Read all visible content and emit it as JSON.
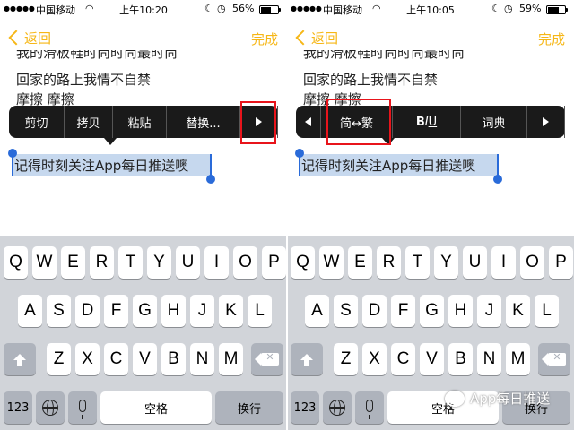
{
  "left": {
    "status": {
      "carrier": "中国移动",
      "time": "上午10:20",
      "battery": "56%",
      "battery_level": 0.56
    },
    "nav": {
      "back_label": "返回",
      "done_label": "完成"
    },
    "note": {
      "partial_line": "我的滑板鞋时尚时尚最时尚",
      "line2": "回家的路上我情不自禁",
      "line3": "摩擦 摩擦",
      "selected": "记得时刻关注App每日推送噢"
    },
    "menu": {
      "cut": "剪切",
      "copy": "拷贝",
      "paste": "粘贴",
      "replace": "替换..."
    }
  },
  "right": {
    "status": {
      "carrier": "中国移动",
      "time": "上午10:05",
      "battery": "59%",
      "battery_level": 0.59
    },
    "nav": {
      "back_label": "返回",
      "done_label": "完成"
    },
    "note": {
      "partial_line": "我的滑板鞋时尚时尚最时尚",
      "line2": "回家的路上我情不自禁",
      "line3": "摩擦 摩擦",
      "selected": "记得时刻关注App每日推送噢"
    },
    "menu": {
      "convert": "简↔繁",
      "bold": "B",
      "italic": "I",
      "underline": "U",
      "dictionary": "词典"
    }
  },
  "keyboard": {
    "row1": [
      "Q",
      "W",
      "E",
      "R",
      "T",
      "Y",
      "U",
      "I",
      "O",
      "P"
    ],
    "row2": [
      "A",
      "S",
      "D",
      "F",
      "G",
      "H",
      "J",
      "K",
      "L"
    ],
    "row3": [
      "Z",
      "X",
      "C",
      "V",
      "B",
      "N",
      "M"
    ],
    "num_label": "123",
    "space_label": "空格",
    "return_label": "换行"
  },
  "watermark": "App每日推送",
  "accent_color": "#f6b717",
  "highlight_color": "#e8141b"
}
